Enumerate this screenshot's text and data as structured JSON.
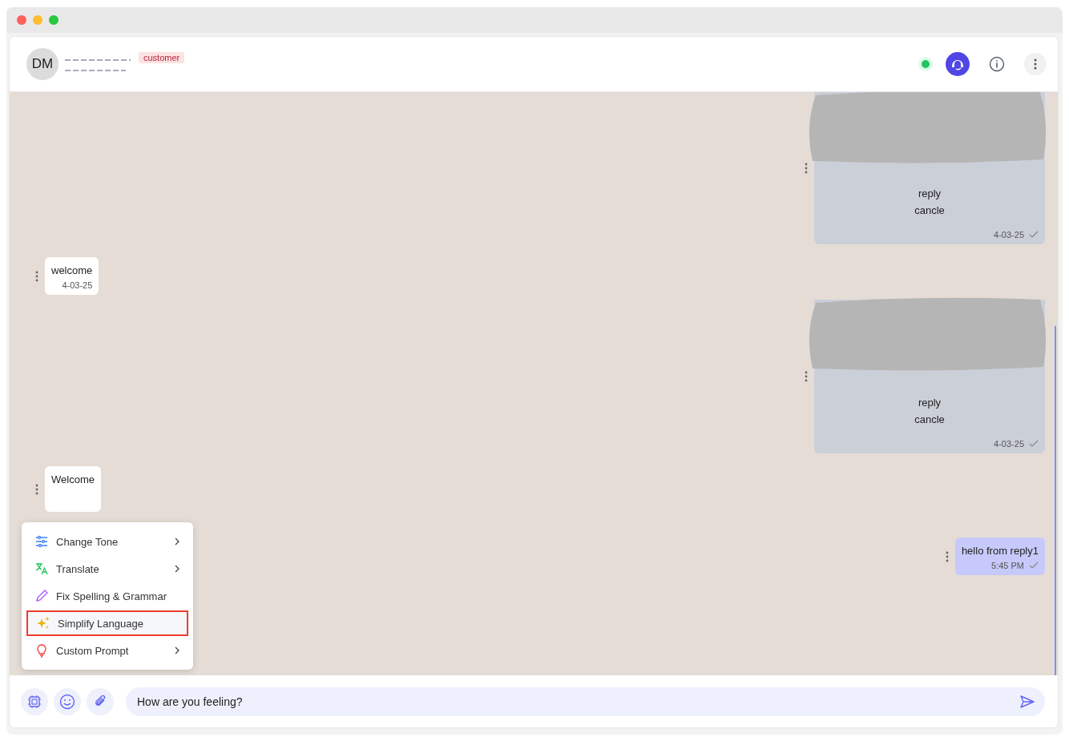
{
  "contact": {
    "initials": "DM",
    "tag": "customer",
    "online": true
  },
  "messages": [
    {
      "kind": "outgoing",
      "redacted": true,
      "lines": [
        "reply",
        "cancle"
      ],
      "time": "4-03-25",
      "delivered": true
    },
    {
      "kind": "incoming",
      "lines": [
        "welcome"
      ],
      "time": "4-03-25"
    },
    {
      "kind": "outgoing",
      "redacted": true,
      "lines": [
        "reply",
        "cancle"
      ],
      "time": "4-03-25",
      "delivered": true
    },
    {
      "kind": "incoming",
      "lines": [
        "Welcome"
      ]
    },
    {
      "kind": "outgoing",
      "redacted": false,
      "lines": [
        "hello from reply1"
      ],
      "time": "5:45 PM",
      "delivered": true
    }
  ],
  "ai_menu": [
    {
      "label": "Change Tone",
      "kind": "submenu",
      "selected": false
    },
    {
      "label": "Translate",
      "kind": "submenu",
      "selected": false
    },
    {
      "label": "Fix Spelling & Grammar",
      "kind": "action",
      "selected": false
    },
    {
      "label": "Simplify Language",
      "kind": "action",
      "selected": true
    },
    {
      "label": "Custom Prompt",
      "kind": "submenu",
      "selected": false
    }
  ],
  "composer": {
    "value": "How are you feeling?"
  }
}
